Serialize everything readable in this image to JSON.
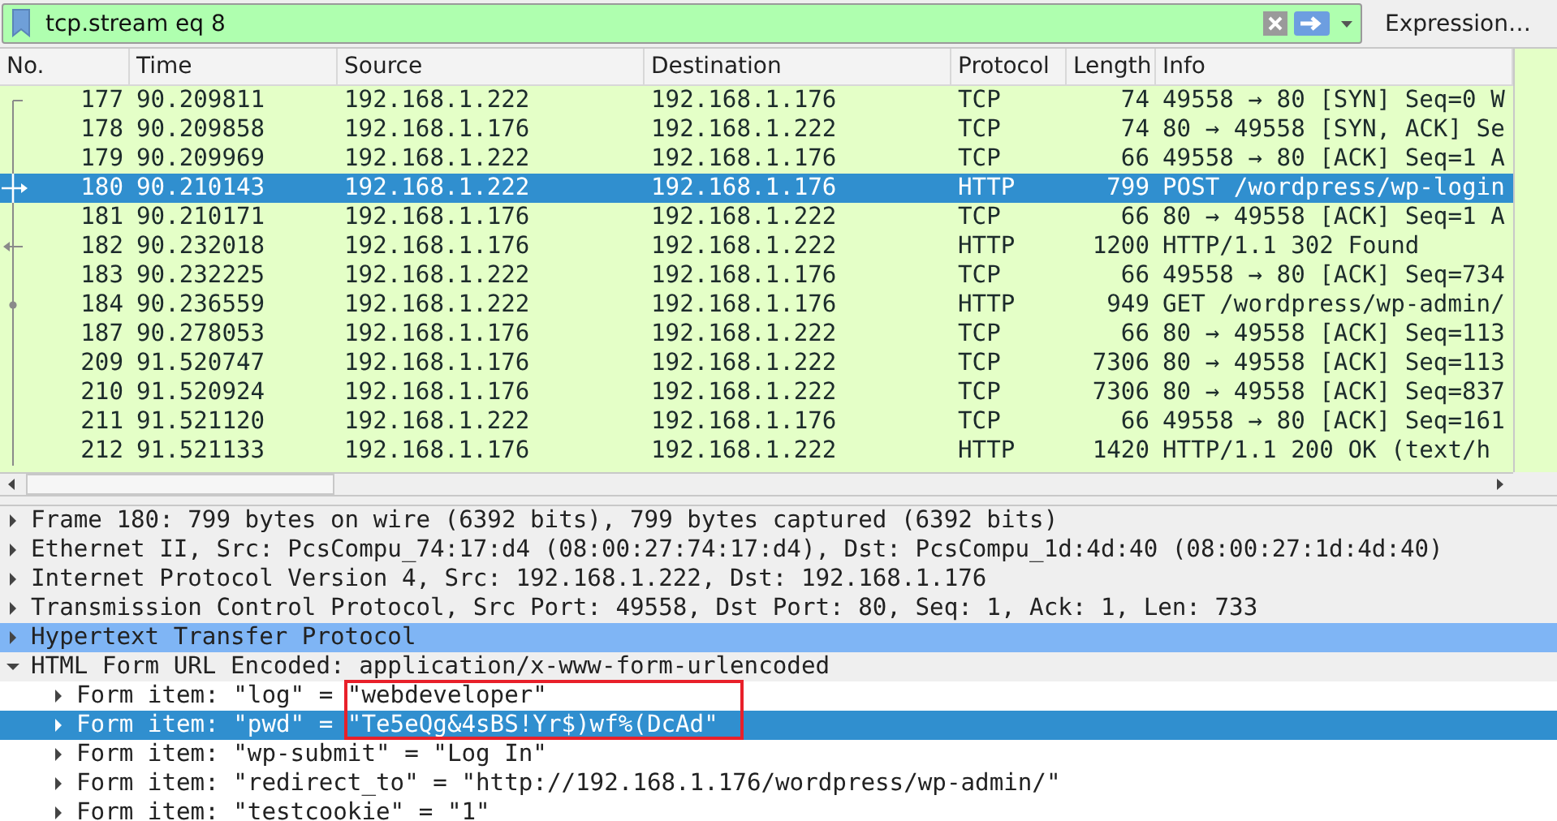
{
  "filter": {
    "value": "tcp.stream eq 8",
    "valid": true,
    "button": "Expression…"
  },
  "packets": {
    "columns": [
      "No.",
      "Time",
      "Source",
      "Destination",
      "Protocol",
      "Length",
      "Info"
    ],
    "rows": [
      {
        "no": "177",
        "time": "90.209811",
        "source": "192.168.1.222",
        "destination": "192.168.1.176",
        "protocol": "TCP",
        "length": "74",
        "info": "49558 → 80 [SYN] Seq=0 W",
        "selected": false,
        "kind": "first"
      },
      {
        "no": "178",
        "time": "90.209858",
        "source": "192.168.1.176",
        "destination": "192.168.1.222",
        "protocol": "TCP",
        "length": "74",
        "info": "80 → 49558 [SYN, ACK] Se",
        "selected": false,
        "kind": "line"
      },
      {
        "no": "179",
        "time": "90.209969",
        "source": "192.168.1.222",
        "destination": "192.168.1.176",
        "protocol": "TCP",
        "length": "66",
        "info": "49558 → 80 [ACK] Seq=1 A",
        "selected": false,
        "kind": "line"
      },
      {
        "no": "180",
        "time": "90.210143",
        "source": "192.168.1.222",
        "destination": "192.168.1.176",
        "protocol": "HTTP",
        "length": "799",
        "info": "POST /wordpress/wp-login",
        "selected": true,
        "kind": "request"
      },
      {
        "no": "181",
        "time": "90.210171",
        "source": "192.168.1.176",
        "destination": "192.168.1.222",
        "protocol": "TCP",
        "length": "66",
        "info": "80 → 49558 [ACK] Seq=1 A",
        "selected": false,
        "kind": "line"
      },
      {
        "no": "182",
        "time": "90.232018",
        "source": "192.168.1.176",
        "destination": "192.168.1.222",
        "protocol": "HTTP",
        "length": "1200",
        "info": "HTTP/1.1 302 Found",
        "selected": false,
        "kind": "response"
      },
      {
        "no": "183",
        "time": "90.232225",
        "source": "192.168.1.222",
        "destination": "192.168.1.176",
        "protocol": "TCP",
        "length": "66",
        "info": "49558 → 80 [ACK] Seq=734",
        "selected": false,
        "kind": "line"
      },
      {
        "no": "184",
        "time": "90.236559",
        "source": "192.168.1.222",
        "destination": "192.168.1.176",
        "protocol": "HTTP",
        "length": "949",
        "info": "GET /wordpress/wp-admin/",
        "selected": false,
        "kind": "related"
      },
      {
        "no": "187",
        "time": "90.278053",
        "source": "192.168.1.176",
        "destination": "192.168.1.222",
        "protocol": "TCP",
        "length": "66",
        "info": "80 → 49558 [ACK] Seq=113",
        "selected": false,
        "kind": "line"
      },
      {
        "no": "209",
        "time": "91.520747",
        "source": "192.168.1.176",
        "destination": "192.168.1.222",
        "protocol": "TCP",
        "length": "7306",
        "info": "80 → 49558 [ACK] Seq=113",
        "selected": false,
        "kind": "line"
      },
      {
        "no": "210",
        "time": "91.520924",
        "source": "192.168.1.176",
        "destination": "192.168.1.222",
        "protocol": "TCP",
        "length": "7306",
        "info": "80 → 49558 [ACK] Seq=837",
        "selected": false,
        "kind": "line"
      },
      {
        "no": "211",
        "time": "91.521120",
        "source": "192.168.1.222",
        "destination": "192.168.1.176",
        "protocol": "TCP",
        "length": "66",
        "info": "49558 → 80 [ACK] Seq=161",
        "selected": false,
        "kind": "line"
      },
      {
        "no": "212",
        "time": "91.521133",
        "source": "192.168.1.176",
        "destination": "192.168.1.222",
        "protocol": "HTTP",
        "length": "1420",
        "info": "HTTP/1.1 200 OK  (text/h",
        "selected": false,
        "kind": "line"
      }
    ]
  },
  "details": {
    "items": [
      {
        "text": "Frame 180: 799 bytes on wire (6392 bits), 799 bytes captured (6392 bits)",
        "expanded": false,
        "selected": false,
        "highlighted": false
      },
      {
        "text": "Ethernet II, Src: PcsCompu_74:17:d4 (08:00:27:74:17:d4), Dst: PcsCompu_1d:4d:40 (08:00:27:1d:4d:40)",
        "expanded": false,
        "selected": false,
        "highlighted": false
      },
      {
        "text": "Internet Protocol Version 4, Src: 192.168.1.222, Dst: 192.168.1.176",
        "expanded": false,
        "selected": false,
        "highlighted": false
      },
      {
        "text": "Transmission Control Protocol, Src Port: 49558, Dst Port: 80, Seq: 1, Ack: 1, Len: 733",
        "expanded": false,
        "selected": false,
        "highlighted": false
      },
      {
        "text": "Hypertext Transfer Protocol",
        "expanded": false,
        "selected": false,
        "highlighted": true
      },
      {
        "text": "HTML Form URL Encoded: application/x-www-form-urlencoded",
        "expanded": true,
        "selected": false,
        "highlighted": false,
        "children": [
          {
            "text": "Form item: \"log\" = \"webdeveloper\"",
            "expanded": false,
            "selected": false,
            "highlighted": false
          },
          {
            "text": "Form item: \"pwd\" = \"Te5eQg&4sBS!Yr$)wf%(DcAd\"",
            "expanded": false,
            "selected": true,
            "highlighted": false
          },
          {
            "text": "Form item: \"wp-submit\" = \"Log In\"",
            "expanded": false,
            "selected": false,
            "highlighted": false
          },
          {
            "text": "Form item: \"redirect_to\" = \"http://192.168.1.176/wordpress/wp-admin/\"",
            "expanded": false,
            "selected": false,
            "highlighted": false
          },
          {
            "text": "Form item: \"testcookie\" = \"1\"",
            "expanded": false,
            "selected": false,
            "highlighted": false
          }
        ]
      }
    ]
  }
}
